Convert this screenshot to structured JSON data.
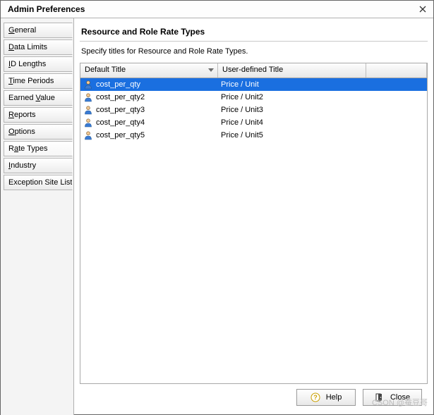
{
  "window": {
    "title": "Admin Preferences"
  },
  "sidebar": {
    "items": [
      {
        "label": "General",
        "accel": "G"
      },
      {
        "label": "Data Limits",
        "accel": "D"
      },
      {
        "label": "ID Lengths",
        "accel": "I"
      },
      {
        "label": "Time Periods",
        "accel": "T"
      },
      {
        "label": "Earned Value",
        "accel": "V"
      },
      {
        "label": "Reports",
        "accel": "R"
      },
      {
        "label": "Options",
        "accel": "O"
      },
      {
        "label": "Rate Types",
        "accel": "a",
        "selected": true
      },
      {
        "label": "Industry",
        "accel": "I"
      },
      {
        "label": "Exception Site List",
        "accel": ""
      }
    ]
  },
  "panel": {
    "title": "Resource and Role Rate Types",
    "description": "Specify titles for Resource and Role Rate Types.",
    "columns": {
      "default": "Default Title",
      "user": "User-defined Title"
    },
    "rows": [
      {
        "default": "cost_per_qty",
        "user": "Price / Unit",
        "selected": true
      },
      {
        "default": "cost_per_qty2",
        "user": "Price / Unit2"
      },
      {
        "default": "cost_per_qty3",
        "user": "Price / Unit3"
      },
      {
        "default": "cost_per_qty4",
        "user": "Price / Unit4"
      },
      {
        "default": "cost_per_qty5",
        "user": "Price / Unit5"
      }
    ]
  },
  "buttons": {
    "help": "Help",
    "close": "Close"
  },
  "watermark": "CSON @蚕豆哥"
}
